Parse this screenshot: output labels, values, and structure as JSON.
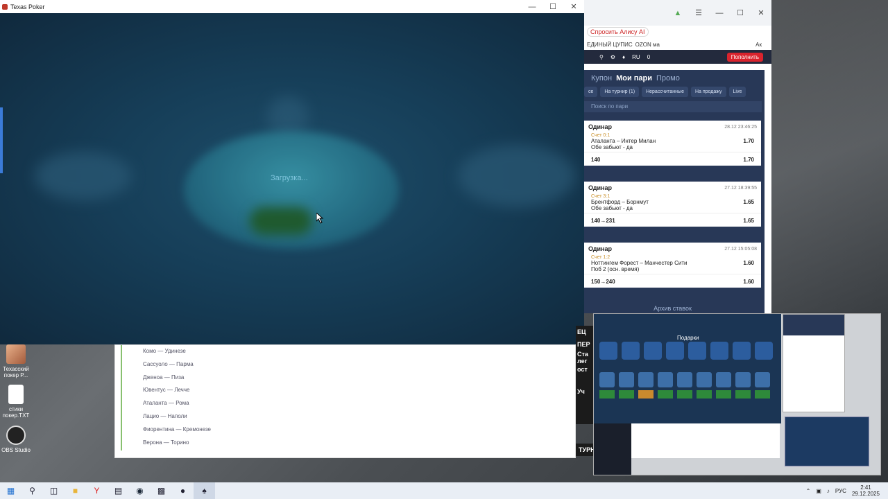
{
  "poker_window": {
    "title": "Texas Poker",
    "loading_text": "Загрузка..."
  },
  "browser_under": {
    "matches": [
      "Комо — Удинезе",
      "Сассуоло — Парма",
      "Дженоа — Пиза",
      "Ювентус — Лечче",
      "Аталанта — Рома",
      "Лацио — Наполи",
      "Фиорентина — Кремонезе",
      "Верона — Торино"
    ]
  },
  "bet_browser": {
    "alisa": "Спросить Алису AI",
    "bookmarks": [
      "ЕДИНЫЙ ЦУПИС",
      "OZON ма",
      "Ак"
    ],
    "bar": {
      "lang": "RU",
      "balance": "0",
      "deposit": "Пополнить"
    },
    "tabs": [
      "Купон",
      "Мои пари",
      "Промо"
    ],
    "filters": [
      "се",
      "На турнир (1)",
      "Нерассчитанные",
      "На продажу",
      "Live"
    ],
    "search_placeholder": "Поиск по пари",
    "bets": [
      {
        "type": "Одинар",
        "date": "28.12 23:46:25",
        "score": "Счет 0:1",
        "match": "Аталанта – Интер Милан",
        "odd": "1.70",
        "market": "Обе забьют - да",
        "stake": "140",
        "total_odd": "1.70"
      },
      {
        "type": "Одинар",
        "date": "27.12 18:39:55",
        "score": "Счет 3:1",
        "match": "Брентфорд – Борнмут",
        "odd": "1.65",
        "market": "Обе забьют - да",
        "stake": "140→231",
        "total_odd": "1.65"
      },
      {
        "type": "Одинар",
        "date": "27.12 15:05:08",
        "score": "Счет 1:2",
        "match": "Ноттингем Форест – Манчестер Сити",
        "odd": "1.60",
        "market": "Поб 2 (осн. время)",
        "stake": "150→240",
        "total_odd": "1.60"
      }
    ],
    "archive": "Архив ставок"
  },
  "preview": {
    "title": "Подарки",
    "left_texts": [
      "ЕЦ",
      "ПЕР",
      "Ста",
      "лег",
      "ост",
      "Уч",
      "ТУРН"
    ]
  },
  "desktop_icons": [
    {
      "label": "Техасский покер P...",
      "icon": "poker-app-icon"
    },
    {
      "label": "стики покер.TXT",
      "icon": "text-file-icon"
    },
    {
      "label": "OBS Studio",
      "icon": "obs-icon"
    }
  ],
  "taskbar": {
    "lang": "РУС",
    "time": "2:41",
    "date": "29.12.2025"
  },
  "colors": {
    "accent_red": "#d9232d",
    "panel": "#283857",
    "poker_bg": "#143349"
  }
}
